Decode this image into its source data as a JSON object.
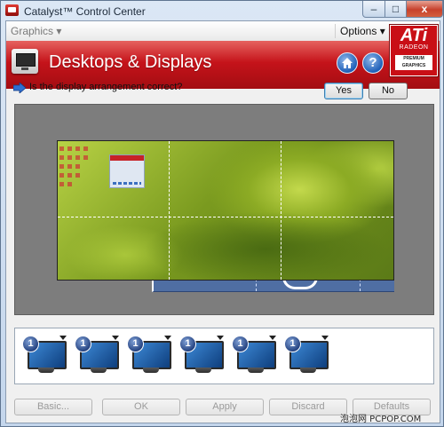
{
  "window": {
    "title": "Catalyst™ Control Center",
    "minimize": "–",
    "maximize": "□",
    "close": "x"
  },
  "menubar": {
    "graphics": "Graphics ▾",
    "options": "Options ▾"
  },
  "header": {
    "title": "Desktops & Displays",
    "help": "?"
  },
  "brand": {
    "logo": "ATi",
    "line": "RADEON",
    "badge": "PREMIUM GRAPHICS"
  },
  "prompt": {
    "text": "Is the display arrangement correct?",
    "yes": "Yes",
    "no": "No"
  },
  "displays": [
    {
      "number": "1"
    },
    {
      "number": "1"
    },
    {
      "number": "1"
    },
    {
      "number": "1"
    },
    {
      "number": "1"
    },
    {
      "number": "1"
    }
  ],
  "footer": {
    "basic": "Basic...",
    "ok": "OK",
    "apply": "Apply",
    "discard": "Discard",
    "defaults": "Defaults"
  },
  "watermark": "泡泡网 PCPOP.COM",
  "colors": {
    "header_red": "#c5131a",
    "accent_blue": "#1e5fb8",
    "arrange_bg": "#7d7d7d"
  }
}
